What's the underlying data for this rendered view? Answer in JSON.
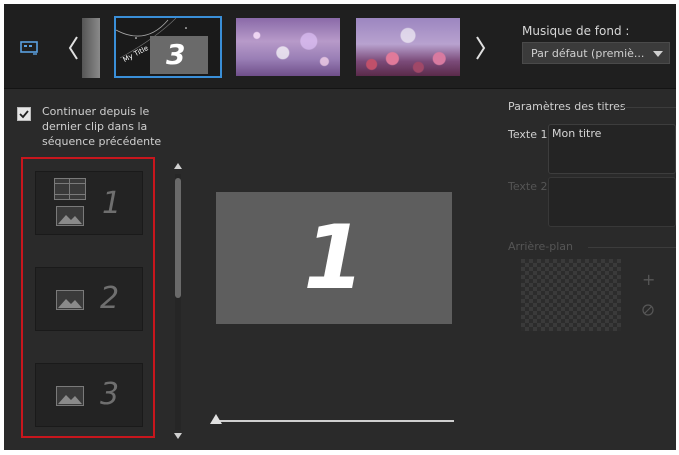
{
  "header": {
    "music_label": "Musique de fond :",
    "music_selected": "Par défaut (premiè...",
    "selected_template_number": "3",
    "selected_template_caption": "My Title"
  },
  "options": {
    "continue_label": "Continuer depuis le dernier clip dans la séquence précédente",
    "continue_checked": true
  },
  "clips": [
    {
      "number": "1"
    },
    {
      "number": "2"
    },
    {
      "number": "3"
    }
  ],
  "preview": {
    "number": "1"
  },
  "title_params": {
    "section_label": "Paramètres des titres",
    "text1_label": "Texte 1",
    "text1_value": "Mon titre",
    "text2_label": "Texte 2",
    "text2_value": "",
    "background_label": "Arrière-plan"
  },
  "colors": {
    "selection_border": "#3a8fd8",
    "clip_list_highlight": "#c8161d",
    "app_background": "#2a2a2a"
  }
}
